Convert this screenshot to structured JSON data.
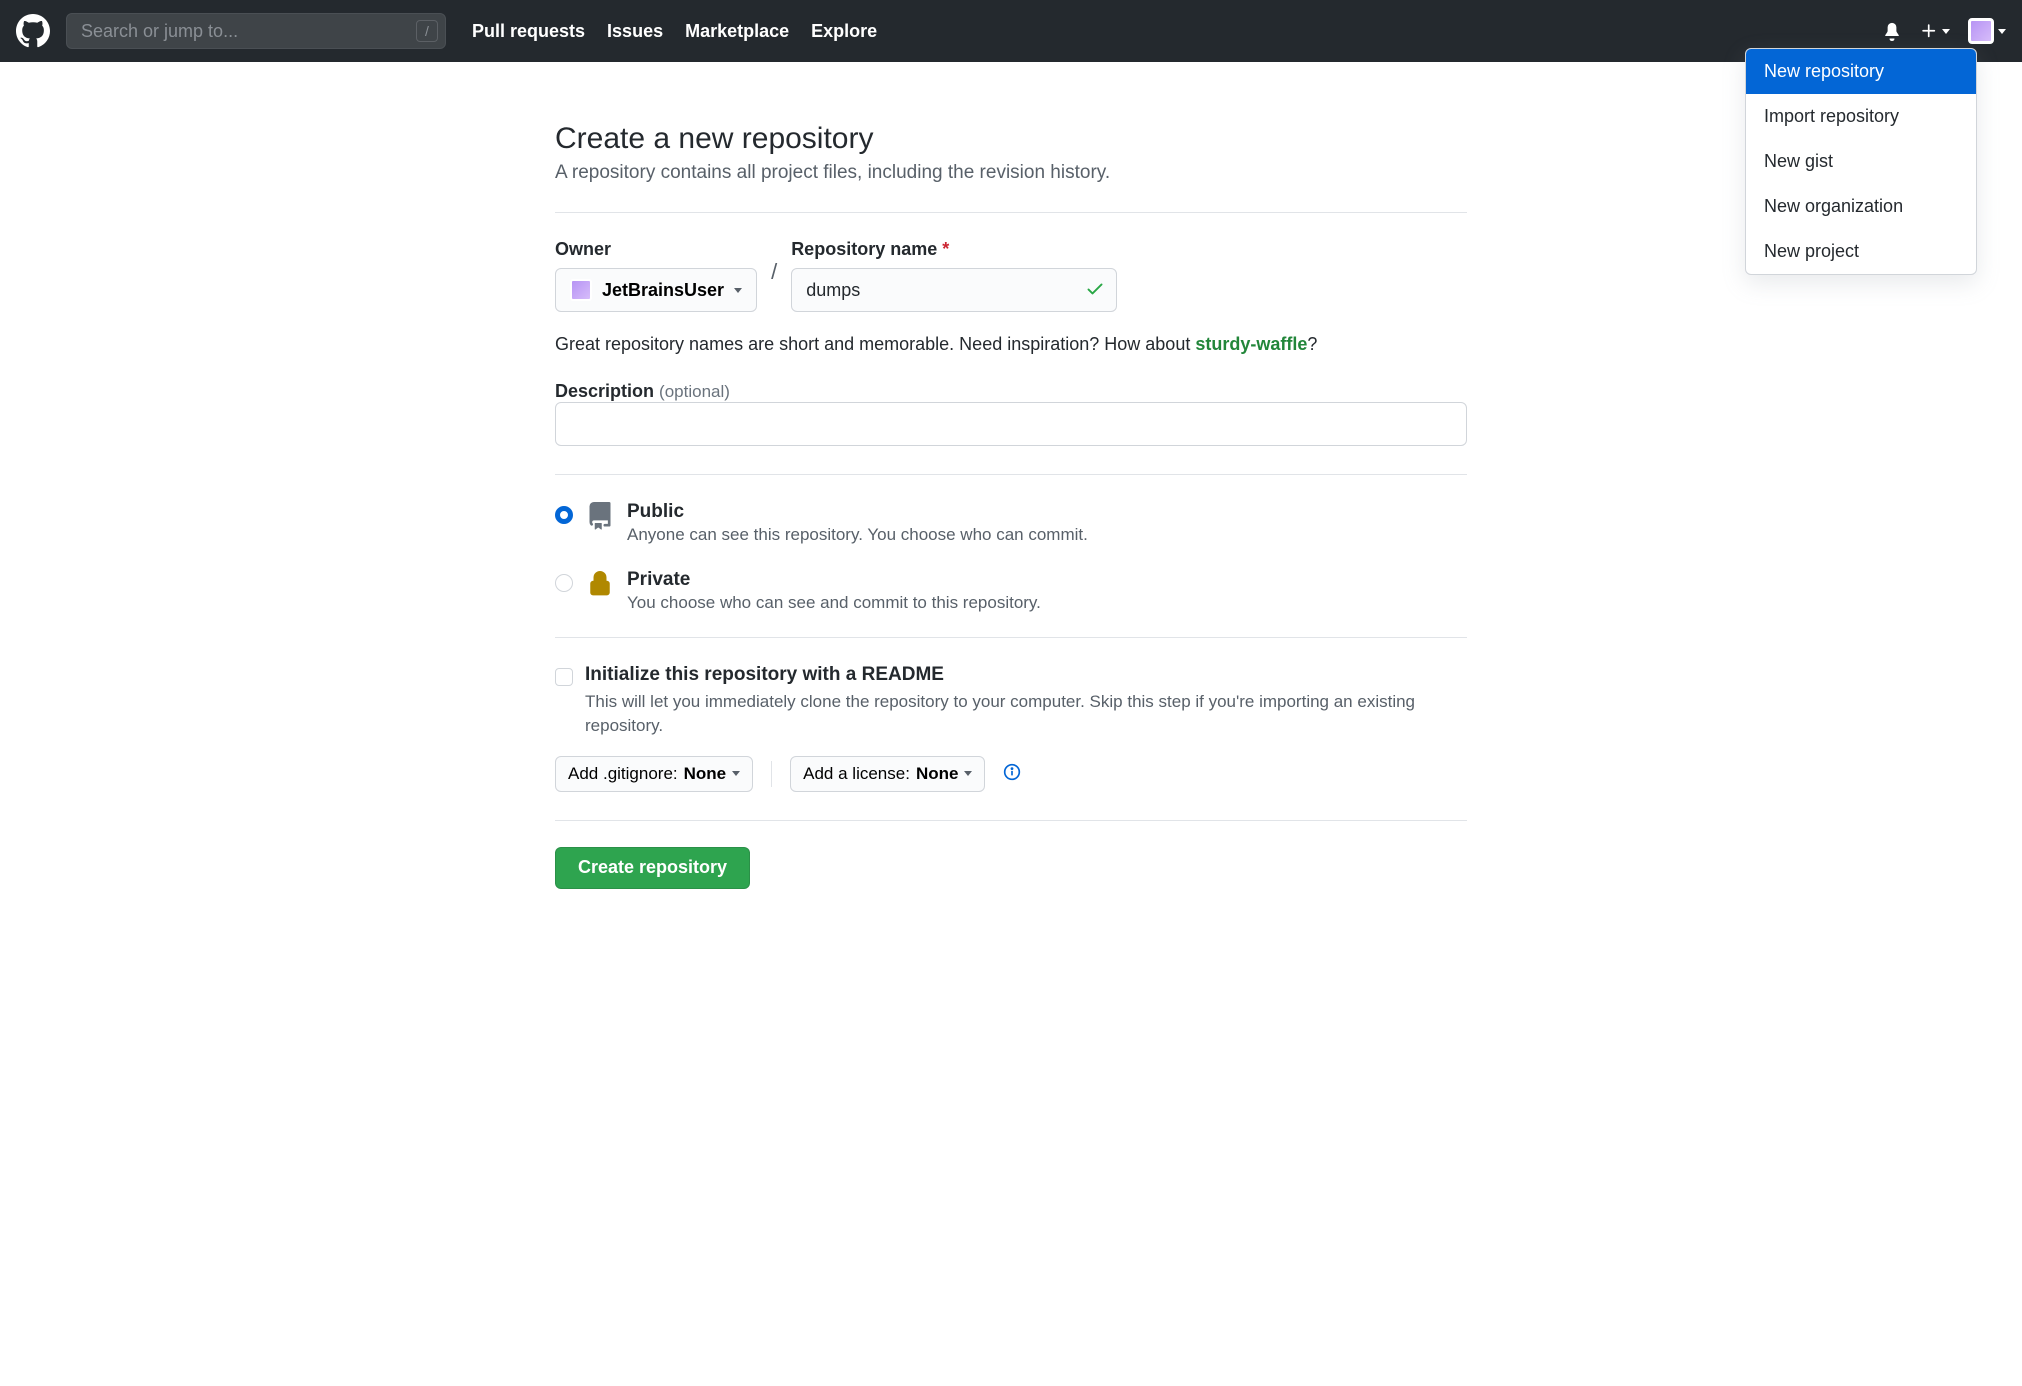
{
  "header": {
    "search_placeholder": "Search or jump to...",
    "nav": [
      "Pull requests",
      "Issues",
      "Marketplace",
      "Explore"
    ]
  },
  "dropdown": {
    "items": [
      "New repository",
      "Import repository",
      "New gist",
      "New organization",
      "New project"
    ],
    "active_index": 0
  },
  "page": {
    "title": "Create a new repository",
    "subtitle": "A repository contains all project files, including the revision history."
  },
  "form": {
    "owner_label": "Owner",
    "owner_value": "JetBrainsUser",
    "repo_label": "Repository name",
    "repo_value": "dumps",
    "hint_prefix": "Great repository names are short and memorable. Need inspiration? How about ",
    "hint_suggestion": "sturdy-waffle",
    "hint_suffix": "?",
    "desc_label": "Description",
    "desc_optional": "(optional)",
    "visibility": [
      {
        "title": "Public",
        "desc": "Anyone can see this repository. You choose who can commit.",
        "checked": true
      },
      {
        "title": "Private",
        "desc": "You choose who can see and commit to this repository.",
        "checked": false
      }
    ],
    "readme_title": "Initialize this repository with a README",
    "readme_desc": "This will let you immediately clone the repository to your computer. Skip this step if you're importing an existing repository.",
    "gitignore_prefix": "Add .gitignore: ",
    "gitignore_value": "None",
    "license_prefix": "Add a license: ",
    "license_value": "None",
    "submit": "Create repository"
  }
}
